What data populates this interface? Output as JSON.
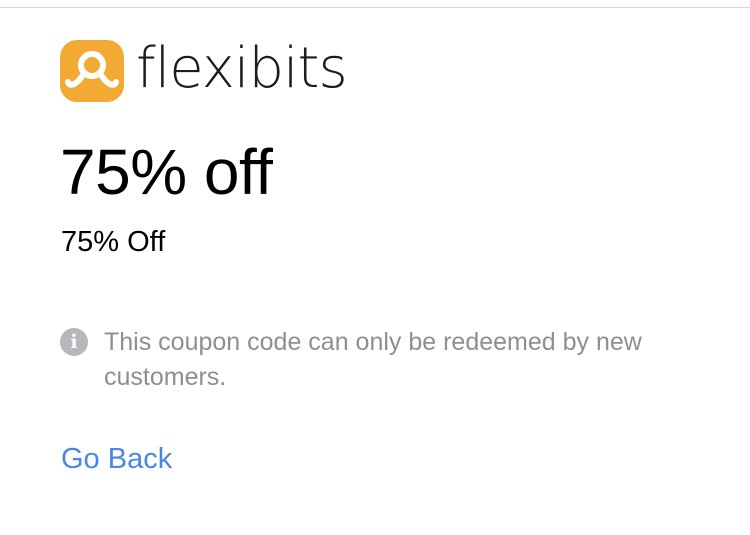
{
  "brand": {
    "name": "flexibits",
    "logo_icon": "flexibits-logo-icon",
    "logo_color": "#F2AA35"
  },
  "deal": {
    "title": "75% off",
    "subtitle": "75% Off"
  },
  "notice": {
    "icon": "info-icon",
    "text": "This coupon code can only be redeemed by new customers."
  },
  "actions": {
    "go_back_label": "Go Back",
    "link_color": "#4A86E8"
  }
}
